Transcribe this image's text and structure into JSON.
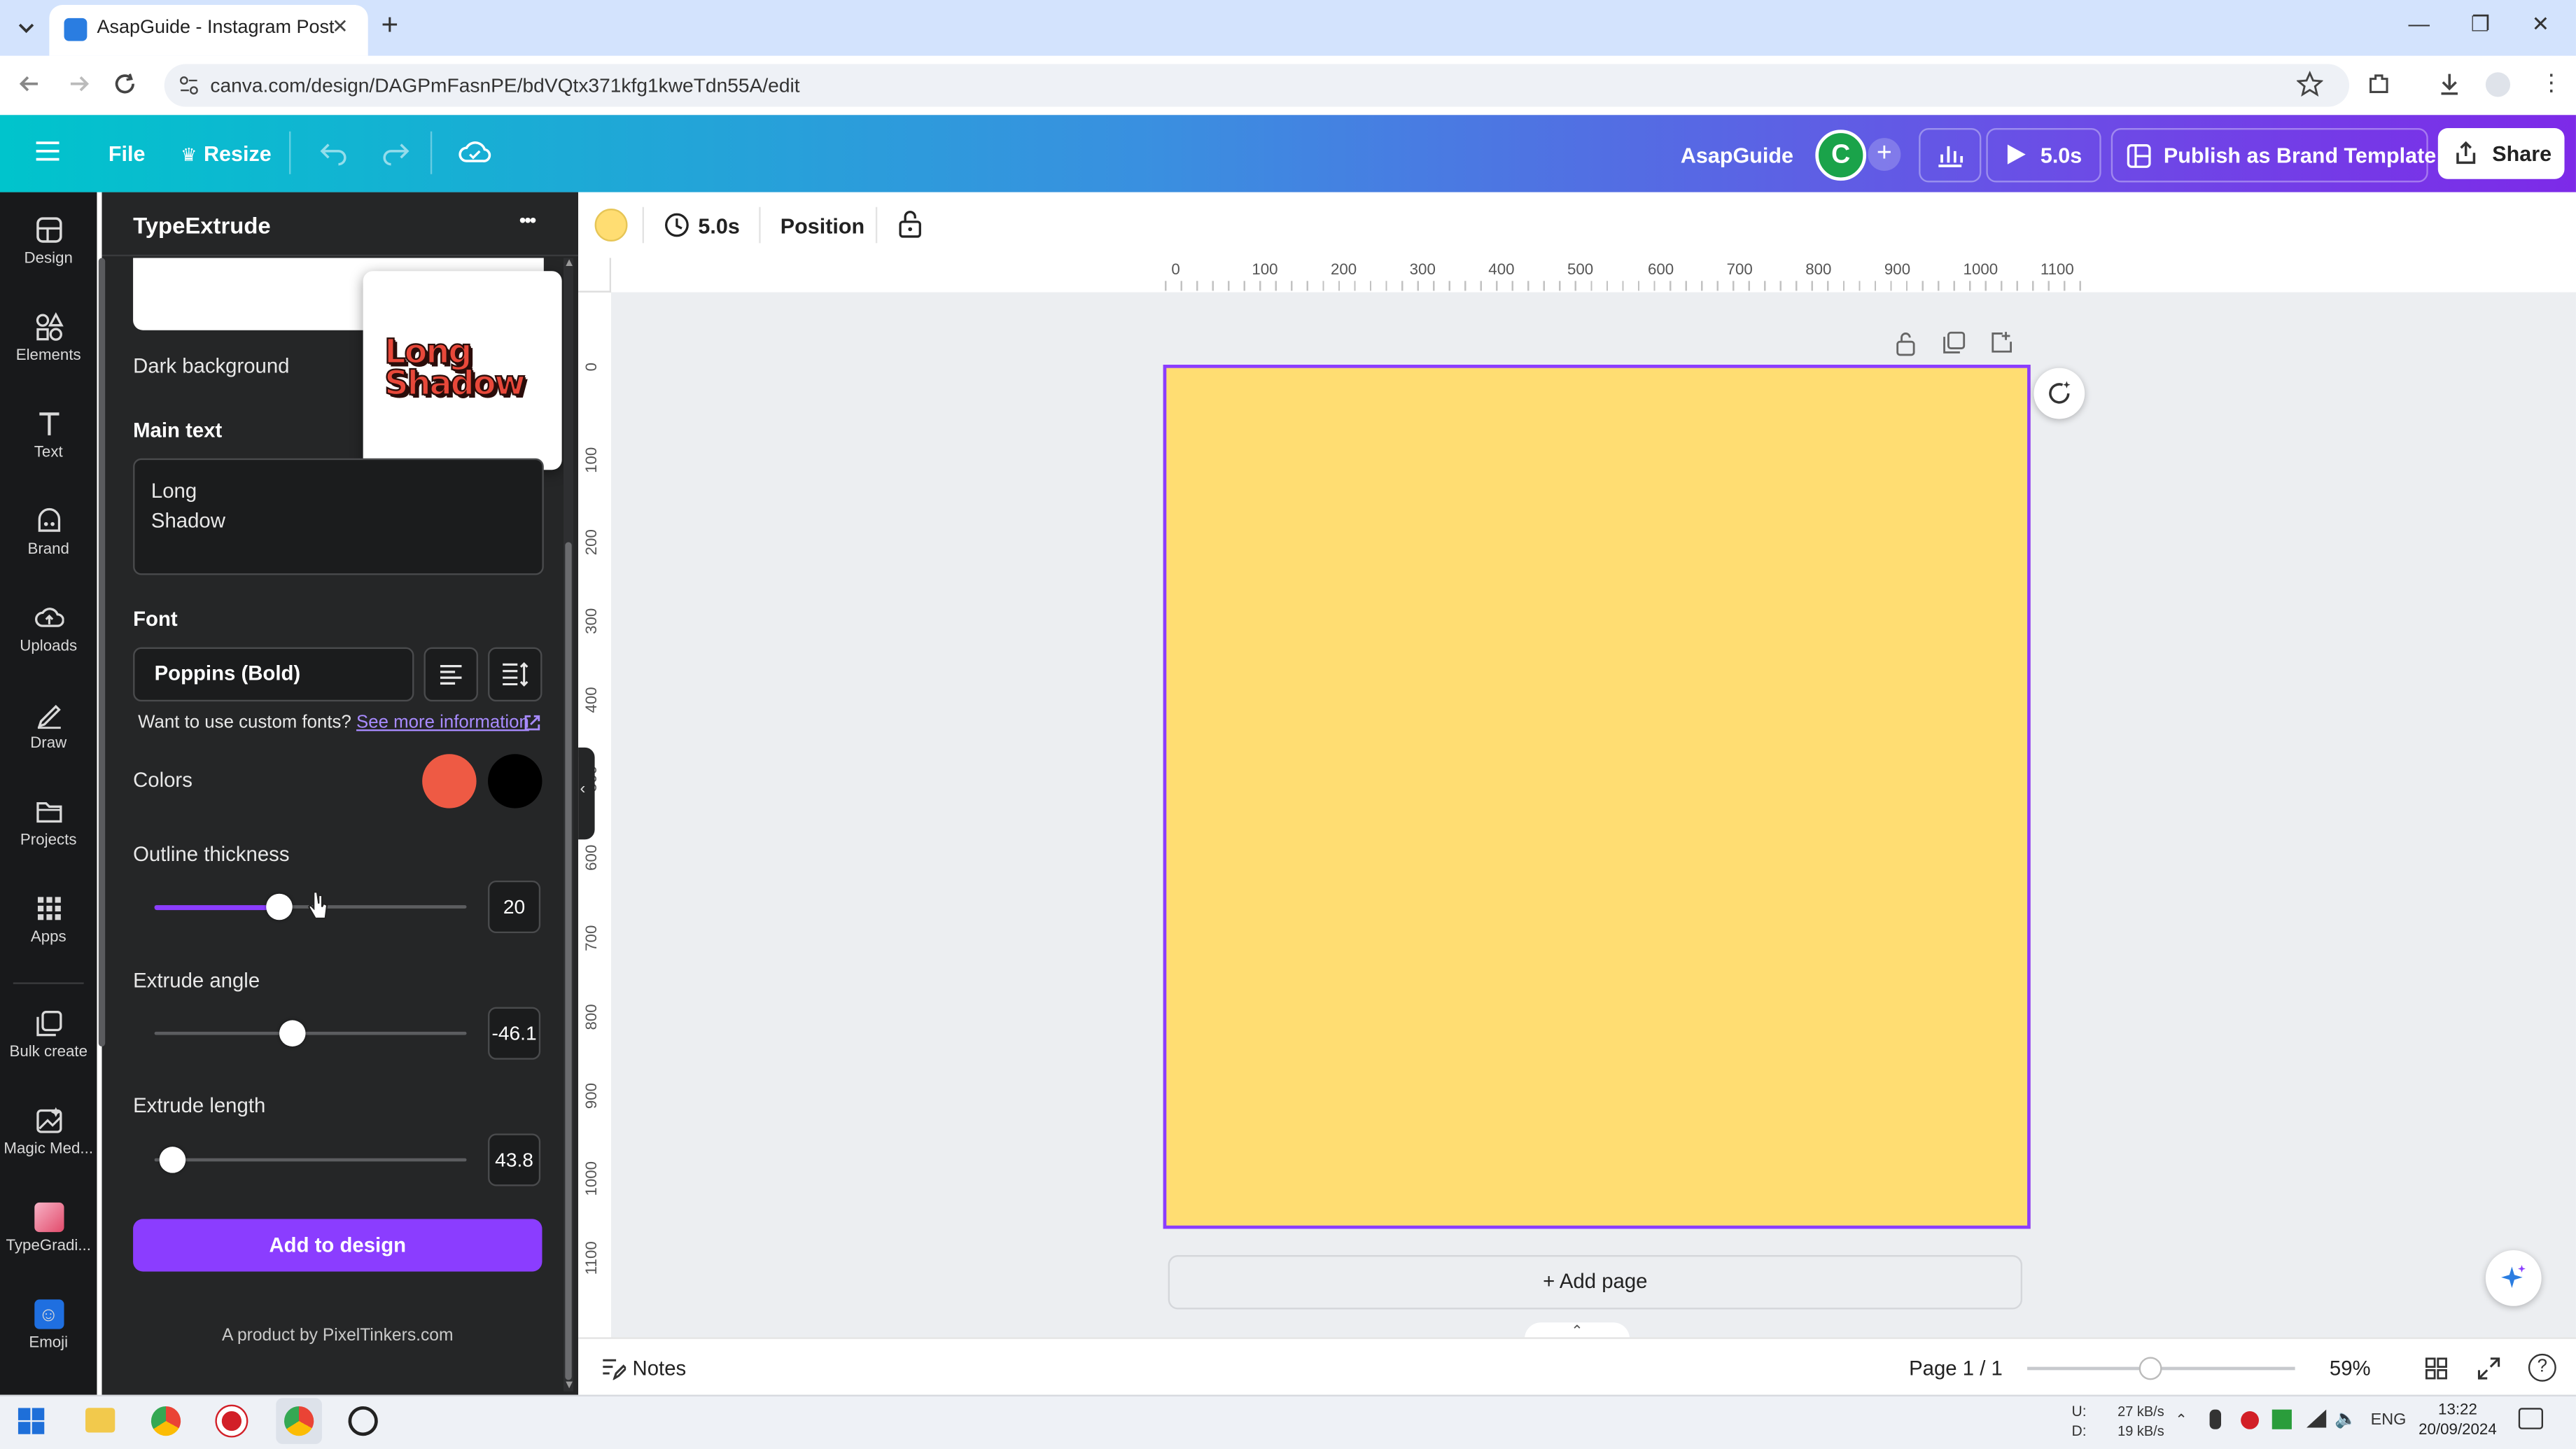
{
  "browser": {
    "tab_title": "AsapGuide - Instagram Post",
    "url": "canva.com/design/DAGPmFasnPE/bdVQtx371kfg1kweTdn55A/edit",
    "tab_close": "✕",
    "new_tab": "+",
    "window_controls": [
      "—",
      "❐",
      "✕"
    ]
  },
  "header": {
    "file_label": "File",
    "resize_label": "Resize",
    "brand_name": "AsapGuide",
    "avatar_letter": "C",
    "play_duration": "5.0s",
    "publish_label": "Publish as Brand Template",
    "share_label": "Share",
    "accent_color": "#8b3dff"
  },
  "rail": {
    "items": [
      {
        "label": "Design",
        "icon": "design-icon"
      },
      {
        "label": "Elements",
        "icon": "elements-icon"
      },
      {
        "label": "Text",
        "icon": "text-icon"
      },
      {
        "label": "Brand",
        "icon": "brand-icon"
      },
      {
        "label": "Uploads",
        "icon": "uploads-icon"
      },
      {
        "label": "Draw",
        "icon": "draw-icon"
      },
      {
        "label": "Projects",
        "icon": "projects-icon"
      },
      {
        "label": "Apps",
        "icon": "apps-icon"
      },
      {
        "label": "Bulk create",
        "icon": "bulk-create-icon"
      },
      {
        "label": "Magic Med...",
        "icon": "magic-media-icon"
      },
      {
        "label": "TypeGradi...",
        "icon": "typegradient-icon"
      },
      {
        "label": "Emoji",
        "icon": "emoji-icon"
      }
    ]
  },
  "panel": {
    "title": "TypeExtrude",
    "more_label": "•••",
    "background_label": "Dark background",
    "preview_line1": "Long",
    "preview_line2": "Shadow",
    "main_text_label": "Main text",
    "main_text_line1": "Long",
    "main_text_line2": "Shadow",
    "font_label": "Font",
    "font_value": "Poppins (Bold)",
    "custom_font_text": "Want to use custom fonts?",
    "custom_font_link": "See more information",
    "colors_label": "Colors",
    "color_primary": "#ee5a44",
    "color_secondary": "#000000",
    "outline_label": "Outline thickness",
    "outline_value": "20",
    "outline_fraction": 0.4,
    "angle_label": "Extrude angle",
    "angle_value": "-46.1",
    "angle_fraction": 0.44,
    "length_label": "Extrude length",
    "length_value": "43.8",
    "length_fraction": 0.06,
    "add_button": "Add to design",
    "credit": "A product by PixelTinkers.com"
  },
  "toolbar": {
    "fill_color": "#ffdd72",
    "duration": "5.0s",
    "position_label": "Position"
  },
  "rulers": {
    "top": [
      "0",
      "100",
      "200",
      "300",
      "400",
      "500",
      "600",
      "700",
      "800",
      "900",
      "1000",
      "1100"
    ],
    "left": [
      "0",
      "100",
      "200",
      "300",
      "400",
      "500",
      "600",
      "700",
      "800",
      "900",
      "1000",
      "1100"
    ]
  },
  "canvas": {
    "page_color": "#ffdd72",
    "add_page_label": "+ Add page"
  },
  "footer": {
    "notes_label": "Notes",
    "page_indicator": "Page 1 / 1",
    "zoom": "59%",
    "zoom_fraction": 0.46
  },
  "taskbar": {
    "net_up_label": "U:",
    "net_down_label": "D:",
    "net_up": "27 kB/s",
    "net_down": "19 kB/s",
    "language": "ENG",
    "time": "13:22",
    "date": "20/09/2024"
  }
}
